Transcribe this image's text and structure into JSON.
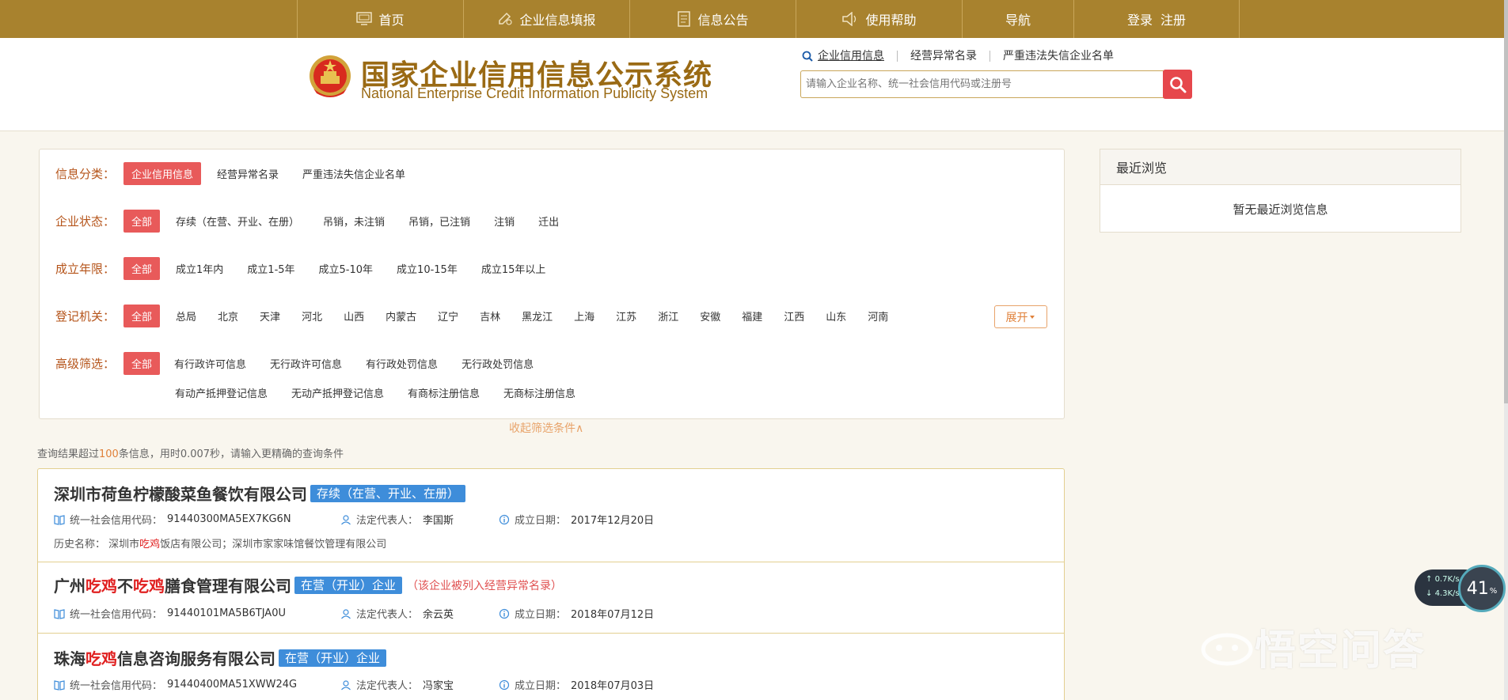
{
  "nav": {
    "items": [
      {
        "label": "首页",
        "icon": "monitor-icon"
      },
      {
        "label": "企业信息填报",
        "icon": "edit-icon"
      },
      {
        "label": "信息公告",
        "icon": "document-icon"
      },
      {
        "label": "使用帮助",
        "icon": "speaker-icon"
      },
      {
        "label": "导航"
      }
    ],
    "login": "登录",
    "register": "注册"
  },
  "header": {
    "title": "国家企业信用信息公示系统",
    "subtitle": "National Enterprise Credit Information Publicity System",
    "search_tabs": [
      "企业信用信息",
      "经营异常名录",
      "严重违法失信企业名单"
    ],
    "search_placeholder": "请输入企业名称、统一社会信用代码或注册号"
  },
  "filters": {
    "category": {
      "label": "信息分类：",
      "options": [
        "企业信用信息",
        "经营异常名录",
        "严重违法失信企业名单"
      ]
    },
    "status": {
      "label": "企业状态：",
      "options": [
        "全部",
        "存续（在营、开业、在册）",
        "吊销，未注销",
        "吊销，已注销",
        "注销",
        "迁出"
      ]
    },
    "age": {
      "label": "成立年限：",
      "options": [
        "全部",
        "成立1年内",
        "成立1-5年",
        "成立5-10年",
        "成立10-15年",
        "成立15年以上"
      ]
    },
    "authority": {
      "label": "登记机关：",
      "options": [
        "全部",
        "总局",
        "北京",
        "天津",
        "河北",
        "山西",
        "内蒙古",
        "辽宁",
        "吉林",
        "黑龙江",
        "上海",
        "江苏",
        "浙江",
        "安徽",
        "福建",
        "江西",
        "山东",
        "河南"
      ],
      "expand": "展开"
    },
    "advanced": {
      "label": "高级筛选：",
      "options": [
        "全部",
        "有行政许可信息",
        "无行政许可信息",
        "有行政处罚信息",
        "无行政处罚信息"
      ],
      "options2": [
        "有动产抵押登记信息",
        "无动产抵押登记信息",
        "有商标注册信息",
        "无商标注册信息"
      ]
    },
    "collapse": "收起筛选条件∧"
  },
  "result_summary": {
    "prefix": "查询结果超过",
    "count": "100",
    "suffix": "条信息，用时0.007秒，请输入更精确的查询条件"
  },
  "results": [
    {
      "name_parts": [
        {
          "t": "深圳市荷鱼柠檬酸菜鱼餐饮有限公司"
        }
      ],
      "status": "存续（在营、开业、在册）",
      "code_label": "统一社会信用代码：",
      "code": "91440300MA5EX7KG6N",
      "rep_label": "法定代表人：",
      "rep": "李国斯",
      "date_label": "成立日期：",
      "date": "2017年12月20日",
      "history_label": "历史名称：",
      "history_parts": [
        {
          "t": "深圳市"
        },
        {
          "t": "吃鸡",
          "hl": true
        },
        {
          "t": "饭店有限公司；深圳市家家味馆餐饮管理有限公司"
        }
      ]
    },
    {
      "name_parts": [
        {
          "t": "广州"
        },
        {
          "t": "吃鸡",
          "hl": true
        },
        {
          "t": "不"
        },
        {
          "t": "吃鸡",
          "hl": true
        },
        {
          "t": "膳食管理有限公司"
        }
      ],
      "status": "在营（开业）企业",
      "warning": "（该企业被列入经营异常名录）",
      "code_label": "统一社会信用代码：",
      "code": "91440101MA5B6TJA0U",
      "rep_label": "法定代表人：",
      "rep": "余云英",
      "date_label": "成立日期：",
      "date": "2018年07月12日"
    },
    {
      "name_parts": [
        {
          "t": "珠海"
        },
        {
          "t": "吃鸡",
          "hl": true
        },
        {
          "t": "信息咨询服务有限公司"
        }
      ],
      "status": "在营（开业）企业",
      "code_label": "统一社会信用代码：",
      "code": "91440400MA51XWW24G",
      "rep_label": "法定代表人：",
      "rep": "冯家宝",
      "date_label": "成立日期：",
      "date": "2018年07月03日"
    }
  ],
  "recent": {
    "title": "最近浏览",
    "empty": "暂无最近浏览信息"
  },
  "speed": {
    "up": "0.7K/s",
    "down": "4.3K/s",
    "percent": "41",
    "unit": "%"
  },
  "watermark": "悟空问答",
  "colors": {
    "nav_bg": "#a8822e",
    "accent_red": "#e85a5a",
    "badge_blue": "#3e8dda",
    "title_gold": "#9a6a14"
  }
}
